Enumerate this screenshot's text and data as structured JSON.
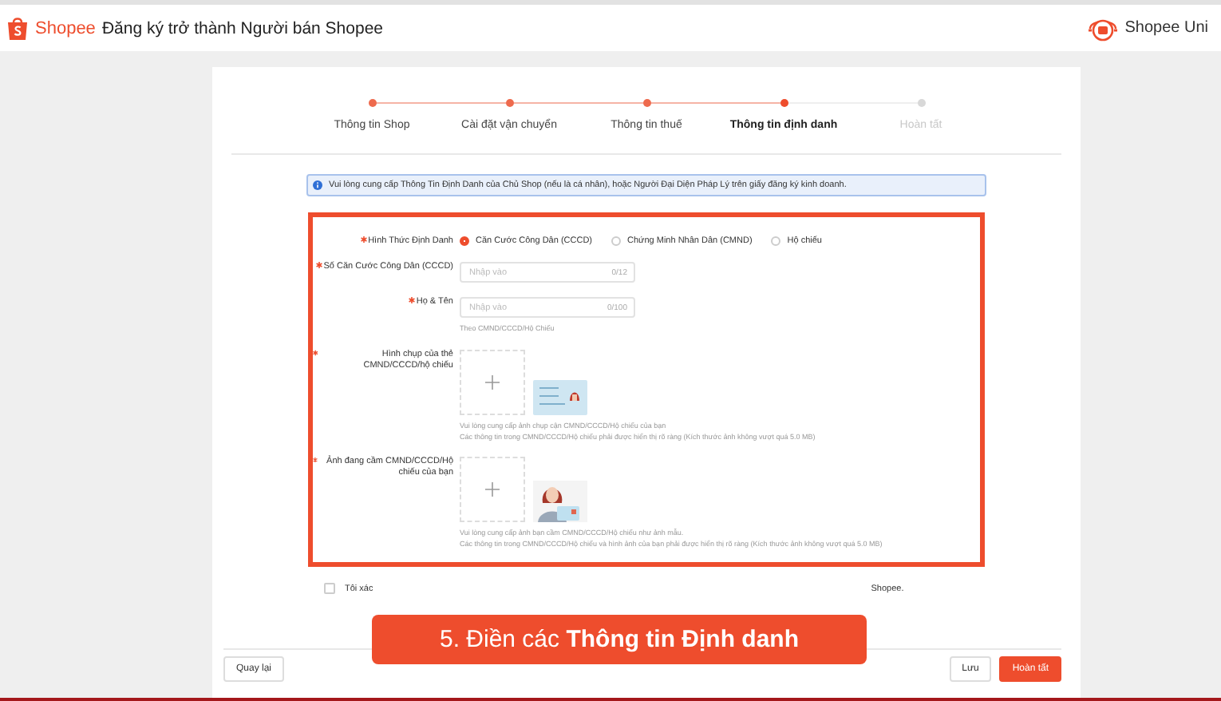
{
  "header": {
    "brand": "Shopee",
    "title": "Đăng ký trở thành Người bán Shopee",
    "uni": "Shopee Uni"
  },
  "steps": [
    {
      "label": "Thông tin Shop",
      "kind": "done"
    },
    {
      "label": "Cài đặt vận chuyển",
      "kind": "done"
    },
    {
      "label": "Thông tin thuế",
      "kind": "done"
    },
    {
      "label": "Thông tin định danh",
      "kind": "current"
    },
    {
      "label": "Hoàn tất",
      "kind": "todo"
    }
  ],
  "notice": "Vui lòng cung cấp Thông Tin Định Danh của Chủ Shop (nếu là cá nhân), hoặc Người Đại Diện Pháp Lý trên giấy đăng ký kinh doanh.",
  "form": {
    "highlighted": true,
    "id_type": {
      "label": "Hình Thức Định Danh",
      "required": true,
      "options": [
        {
          "label": "Căn Cước Công Dân (CCCD)",
          "selected": true
        },
        {
          "label": "Chứng Minh Nhân Dân (CMND)",
          "selected": false
        },
        {
          "label": "Hộ chiếu",
          "selected": false
        }
      ]
    },
    "fields": [
      {
        "kind": "text",
        "label": "Số Căn Cước Công Dân (CCCD)",
        "required": true,
        "placeholder": "Nhập vào",
        "counter": "0/12"
      },
      {
        "kind": "text",
        "label": "Họ & Tên",
        "required": true,
        "placeholder": "Nhập vào",
        "counter": "0/100",
        "hint": "Theo CMND/CCCD/Hộ Chiếu"
      },
      {
        "kind": "card",
        "label": "Hình chụp của thẻ CMND/CCCD/hộ chiếu",
        "required": true,
        "hints": [
          "Vui lòng cung cấp ảnh chụp cận CMND/CCCD/Hộ chiếu của bạn",
          "Các thông tin trong CMND/CCCD/Hộ chiếu phải được hiển thị rõ ràng (Kích thước ảnh không vượt quá 5.0 MB)"
        ]
      },
      {
        "kind": "selfie",
        "label": "Ảnh đang cầm CMND/CCCD/Hộ chiếu của bạn",
        "required": true,
        "hints": [
          "Vui lòng cung cấp ảnh bạn cầm CMND/CCCD/Hộ chiếu như ảnh mẫu.",
          "Các thông tin trong CMND/CCCD/Hộ chiếu và hình ảnh của bạn phải được hiển thị rõ ràng (Kích thước ảnh không vượt quá 5.0 MB)"
        ]
      }
    ]
  },
  "confirm": {
    "checked": false,
    "text_start": "Tôi xác",
    "text_end": "Shopee."
  },
  "banner": "5. Điền các **Thông tin Định danh**",
  "buttons": {
    "back": "Quay lại",
    "save": "Lưu",
    "finish": "Hoàn tất"
  }
}
